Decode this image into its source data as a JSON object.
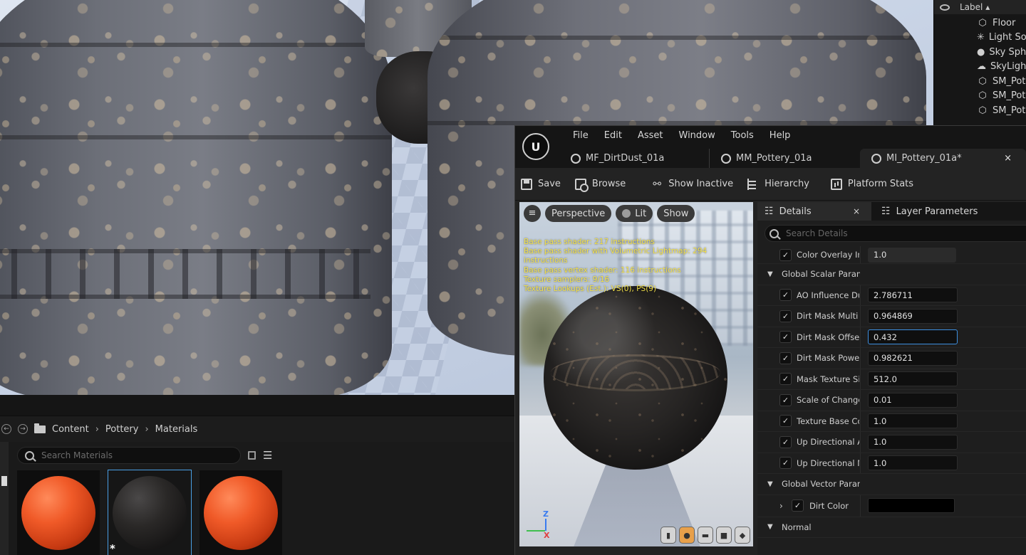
{
  "outliner": {
    "header_label": "Label",
    "items": [
      {
        "label": "Floor",
        "icon": "mesh-icon"
      },
      {
        "label": "Light So",
        "icon": "light-icon"
      },
      {
        "label": "Sky Sph",
        "icon": "sphere-icon"
      },
      {
        "label": "SkyLigh",
        "icon": "skylight-icon"
      },
      {
        "label": "SM_Pot",
        "icon": "mesh-icon"
      },
      {
        "label": "SM_Pot",
        "icon": "mesh-icon"
      },
      {
        "label": "SM_Pot",
        "icon": "mesh-icon"
      }
    ]
  },
  "content_browser": {
    "breadcrumb": [
      "Content",
      "Pottery",
      "Materials"
    ],
    "search_placeholder": "Search Materials",
    "thumbnails": [
      {
        "style": "orange",
        "bar_color": "#3b8fd6",
        "selected": false,
        "unsaved": false
      },
      {
        "style": "dark",
        "bar_color": "#3fae4a",
        "selected": true,
        "unsaved": true
      },
      {
        "style": "orange",
        "bar_color": "#3fae4a",
        "selected": false,
        "unsaved": false
      }
    ],
    "unsaved_marker": "*"
  },
  "editor": {
    "logo_text": "U",
    "menu": [
      "File",
      "Edit",
      "Asset",
      "Window",
      "Tools",
      "Help"
    ],
    "tabs": [
      "MF_DirtDust_01a",
      "MM_Pottery_01a",
      "MI_Pottery_01a*"
    ],
    "close_glyph": "×",
    "toolbar": {
      "save": "Save",
      "browse": "Browse",
      "show_inactive": "Show Inactive",
      "hierarchy": "Hierarchy",
      "platform_stats": "Platform Stats"
    },
    "preview": {
      "perspective": "Perspective",
      "lit": "Lit",
      "show": "Show",
      "stats": [
        "Base pass shader: 217 instructions",
        "Base pass shader with Volumetric Lightmap: 294 instructions",
        "Base pass vertex shader: 116 instructions",
        "Texture samplers: 9/16",
        "Texture Lookups (Est.): VS(0), PS(9)"
      ],
      "axis_z": "Z",
      "axis_x": "X"
    },
    "details": {
      "tab_details": "Details",
      "tab_layers": "Layer Parameters",
      "search_placeholder": "Search Details",
      "color_overlay": {
        "name": "Color Overlay Inf",
        "value": "1.0"
      },
      "global_scalar_label": "Global Scalar Parame",
      "scalar_params": [
        {
          "name": "AO Influence Dus",
          "value": "2.786711",
          "focused": false
        },
        {
          "name": "Dirt Mask Multi",
          "value": "0.964869",
          "focused": false
        },
        {
          "name": "Dirt Mask Offset",
          "value": "0.432",
          "focused": true
        },
        {
          "name": "Dirt Mask Power",
          "value": "0.982621",
          "focused": false
        },
        {
          "name": "Mask Texture Si",
          "value": "512.0",
          "focused": false
        },
        {
          "name": "Scale of Change",
          "value": "0.01",
          "focused": false
        },
        {
          "name": "Texture Base Co",
          "value": "1.0",
          "focused": false
        },
        {
          "name": "Up Directional Ad",
          "value": "1.0",
          "focused": false
        },
        {
          "name": "Up Directional Mi",
          "value": "1.0",
          "focused": false
        }
      ],
      "global_vector_label": "Global Vector Parame",
      "dirt_color": {
        "name": "Dirt Color",
        "color": "#000000"
      },
      "normal_label": "Normal",
      "check_glyph": "✓"
    }
  }
}
